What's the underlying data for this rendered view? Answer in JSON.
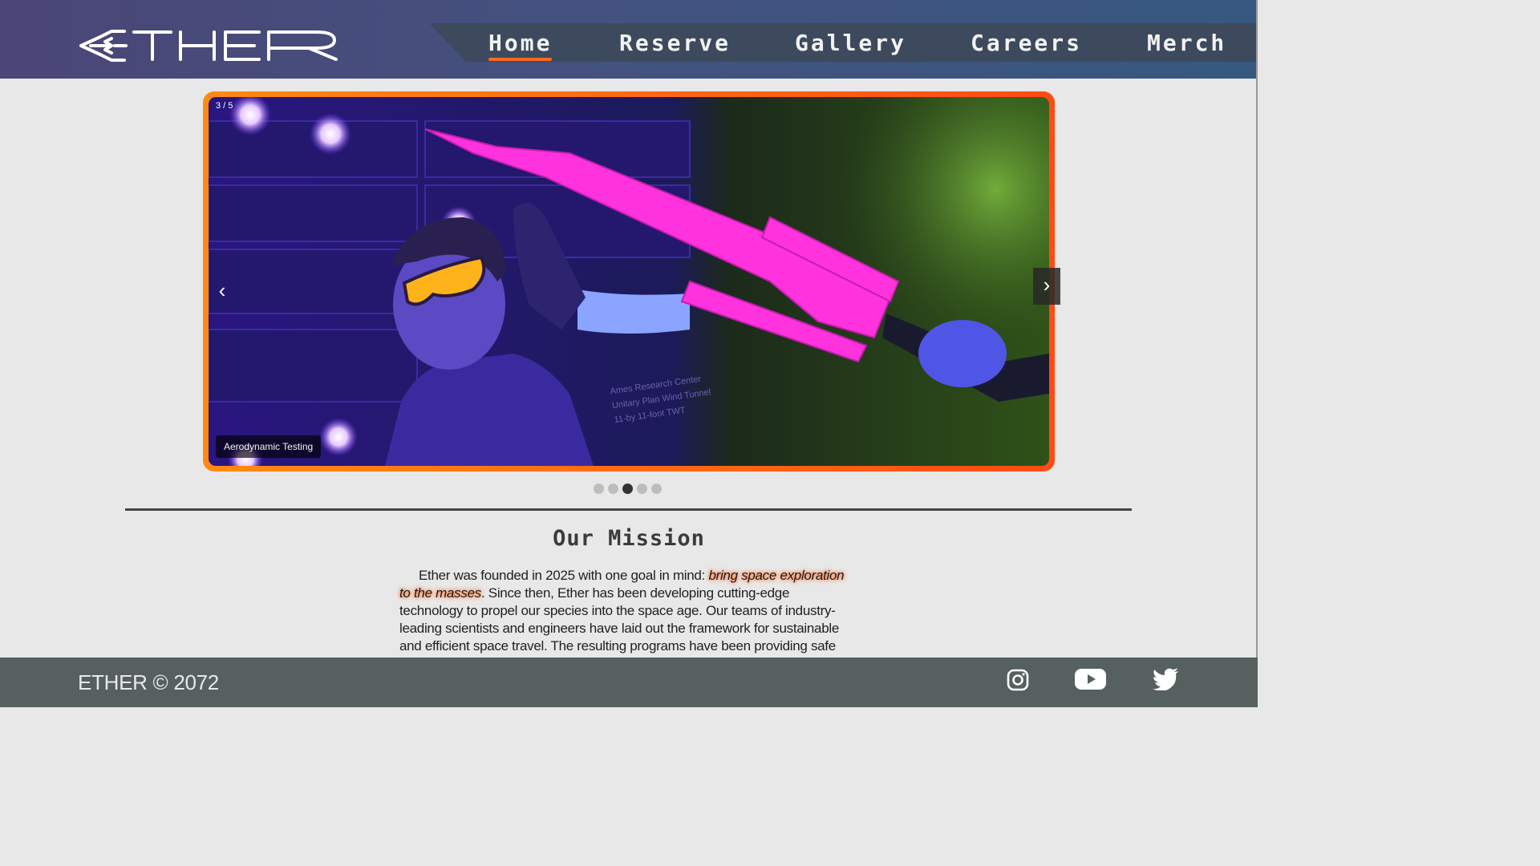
{
  "brand": {
    "logo_text": "ETHER"
  },
  "nav": {
    "items": [
      {
        "label": "Home",
        "active": true
      },
      {
        "label": "Reserve",
        "active": false
      },
      {
        "label": "Gallery",
        "active": false
      },
      {
        "label": "Careers",
        "active": false
      },
      {
        "label": "Merch",
        "active": false
      }
    ]
  },
  "carousel": {
    "counter": "3 / 5",
    "caption": "Aerodynamic Testing",
    "prev_label": "‹",
    "next_label": "›",
    "total_slides": 5,
    "active_slide": 3,
    "image_text": [
      "Ames Research Center",
      "Unitary Plan Wind Tunnel",
      "11-by 11-foot TWT"
    ]
  },
  "mission": {
    "title": "Our Mission",
    "text_before": "Ether was founded in 2025 with one goal in mind: ",
    "text_highlight": "bring space exploration to the masses",
    "text_after": ". Since then, Ether has been developing cutting-edge technology to propel our species into the space age. Our teams of industry-leading scientists and engineers have laid out the framework for sustainable and efficient space travel. The resulting programs have been providing safe and affordable tourism"
  },
  "footer": {
    "copyright": "ETHER © 2072",
    "social": [
      "instagram-icon",
      "youtube-icon",
      "twitter-icon"
    ]
  },
  "colors": {
    "accent": "#ff6a1e",
    "header_start": "#4a4677",
    "header_end": "#36587f",
    "footer": "#55605f",
    "background": "#e8e8e8"
  }
}
